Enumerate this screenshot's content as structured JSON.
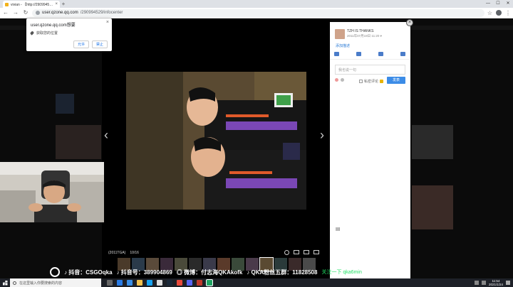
{
  "tab": {
    "title": "vivian - 【http://290994529.q...",
    "close": "×",
    "new_tab": "+"
  },
  "window_controls": {
    "minimize": "—",
    "maximize": "☐",
    "close": "✕"
  },
  "nav": {
    "back": "←",
    "forward": "→",
    "reload": "↻"
  },
  "address": {
    "host": "user.qzone.qq.com",
    "path": "/290994529/infocenter"
  },
  "toolbar_right": {
    "star": "☆",
    "menu": "⋮"
  },
  "permission": {
    "host": "user.qzone.qq.com想要",
    "request": "获取您的位置",
    "close": "×",
    "allow": "允许",
    "block": "禁止"
  },
  "viewer": {
    "prev": "‹",
    "next": "›",
    "album": "(2011TGA)",
    "counter": "10/16"
  },
  "panel": {
    "user_name": "TZH IS THANKS",
    "date": "2011年07月19日 11:20 ▾",
    "add_desc": "添加描述",
    "comment_placeholder": "我也说一句",
    "private_label": "私密评论",
    "send": "发表",
    "close": "×"
  },
  "banner": {
    "douyin1": "♪ 抖音：CSGOqka",
    "douyin2": "♪ 抖音号：389904869",
    "weibo": "◎ 微博：付志海QKAkofk",
    "fans": "♪ QKA粉丝五群：11828508",
    "green": "关注一下 qka6min"
  },
  "taskbar": {
    "search": "在这里输入你要搜索的内容",
    "time": "11:54",
    "date": "2021/1/24"
  },
  "colors": {
    "accent": "#3c8ce7",
    "page_bg": "#0b0b0b",
    "taskbar": "#1e2128",
    "banner_green": "#21e065"
  }
}
